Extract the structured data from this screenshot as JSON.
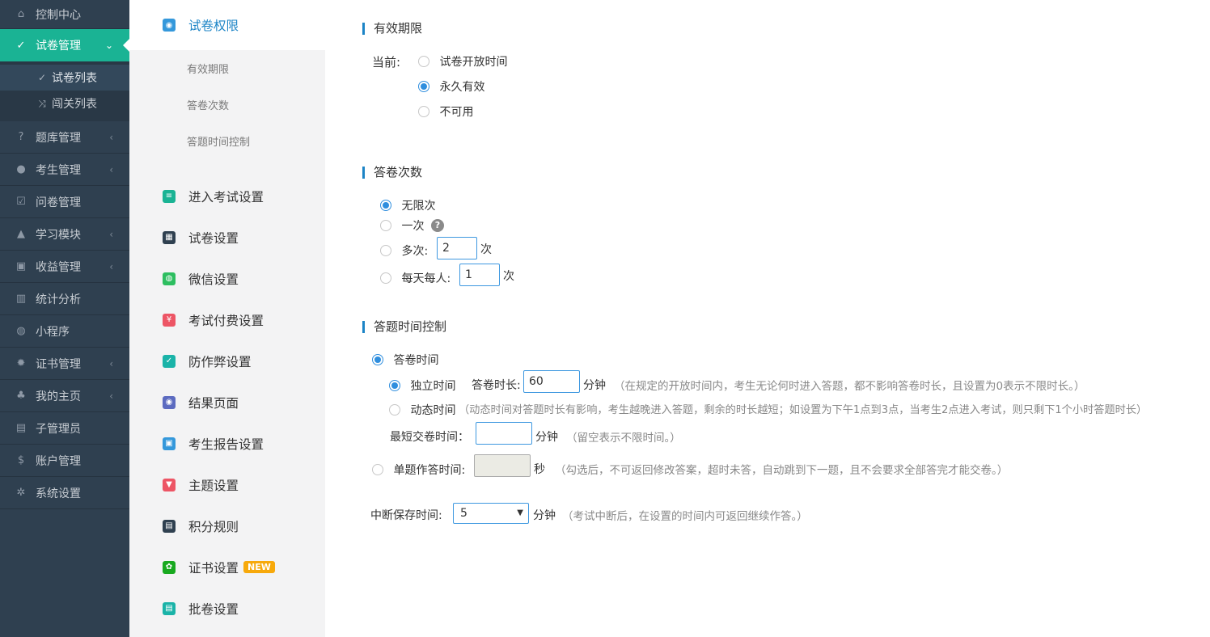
{
  "sidebar": {
    "items": [
      {
        "label": "控制中心",
        "icon": "home-icon",
        "glyph": "⌂",
        "chevron": ""
      },
      {
        "label": "试卷管理",
        "icon": "check-circle-icon",
        "glyph": "✓",
        "chevron": "⌄",
        "active": true
      },
      {
        "label": "题库管理",
        "icon": "question-circle-icon",
        "glyph": "?",
        "chevron": "‹"
      },
      {
        "label": "考生管理",
        "icon": "user-icon",
        "glyph": "●",
        "chevron": "‹"
      },
      {
        "label": "问卷管理",
        "icon": "checkbox-icon",
        "glyph": "☑",
        "chevron": ""
      },
      {
        "label": "学习模块",
        "icon": "graduation-cap-icon",
        "glyph": "▲",
        "chevron": "‹"
      },
      {
        "label": "收益管理",
        "icon": "money-icon",
        "glyph": "▣",
        "chevron": "‹"
      },
      {
        "label": "统计分析",
        "icon": "bar-chart-icon",
        "glyph": "▥",
        "chevron": ""
      },
      {
        "label": "小程序",
        "icon": "wechat-icon",
        "glyph": "◍",
        "chevron": ""
      },
      {
        "label": "证书管理",
        "icon": "certificate-icon",
        "glyph": "✹",
        "chevron": "‹"
      },
      {
        "label": "我的主页",
        "icon": "tree-icon",
        "glyph": "♣",
        "chevron": "‹"
      },
      {
        "label": "子管理员",
        "icon": "admin-icon",
        "glyph": "▤",
        "chevron": ""
      },
      {
        "label": "账户管理",
        "icon": "dollar-icon",
        "glyph": "$",
        "chevron": ""
      },
      {
        "label": "系统设置",
        "icon": "gear-icon",
        "glyph": "✲",
        "chevron": ""
      }
    ],
    "sub_items": [
      {
        "label": "试卷列表",
        "icon": "check-circle-icon",
        "glyph": "✓",
        "active": true
      },
      {
        "label": "闯关列表",
        "icon": "shuffle-icon",
        "glyph": "⤨",
        "active": false
      }
    ]
  },
  "settings_nav": {
    "items": [
      {
        "label": "试卷权限",
        "icon": "permission-icon",
        "glyph": "◉",
        "color": "#3498db",
        "active": true
      },
      {
        "label": "进入考试设置",
        "icon": "enter-exam-icon",
        "glyph": "≡",
        "color": "#1ab394"
      },
      {
        "label": "试卷设置",
        "icon": "paper-settings-icon",
        "glyph": "▦",
        "color": "#2f4050"
      },
      {
        "label": "微信设置",
        "icon": "wechat-settings-icon",
        "glyph": "◍",
        "color": "#2dbe60"
      },
      {
        "label": "考试付费设置",
        "icon": "payment-icon",
        "glyph": "¥",
        "color": "#ed5565"
      },
      {
        "label": "防作弊设置",
        "icon": "anti-cheat-icon",
        "glyph": "✓",
        "color": "#1ab3a8"
      },
      {
        "label": "结果页面",
        "icon": "eye-icon",
        "glyph": "◉",
        "color": "#5c6bc0"
      },
      {
        "label": "考生报告设置",
        "icon": "report-icon",
        "glyph": "▣",
        "color": "#3498db"
      },
      {
        "label": "主题设置",
        "icon": "shirt-icon",
        "glyph": "▼",
        "color": "#ed5565"
      },
      {
        "label": "积分规则",
        "icon": "gift-icon",
        "glyph": "▤",
        "color": "#2f4050"
      },
      {
        "label": "证书设置",
        "icon": "certificate-settings-icon",
        "glyph": "✿",
        "color": "#18a91f",
        "badge": "NEW"
      },
      {
        "label": "批卷设置",
        "icon": "grading-icon",
        "glyph": "▤",
        "color": "#1ab3a8"
      }
    ],
    "sub_items": [
      "有效期限",
      "答卷次数",
      "答题时间控制"
    ]
  },
  "validity": {
    "title": "有效期限",
    "current_label": "当前:",
    "options": [
      "试卷开放时间",
      "永久有效",
      "不可用"
    ],
    "selected": 1
  },
  "attempts": {
    "title": "答卷次数",
    "unlimited": "无限次",
    "once": "一次",
    "help": "?",
    "multiple": "多次:",
    "multiple_value": "2",
    "per_day": "每天每人:",
    "per_day_value": "1",
    "unit": "次"
  },
  "time_control": {
    "title": "答题时间控制",
    "exam_time": "答卷时间",
    "independent": "独立时间",
    "duration_label": "答卷时长:",
    "duration_value": "60",
    "minutes": "分钟",
    "independent_hint": "（在规定的开放时间内，考生无论何时进入答题，都不影响答卷时长，且设置为0表示不限时长。）",
    "dynamic": "动态时间",
    "dynamic_hint": "（动态时间对答题时长有影响，考生越晚进入答题，剩余的时长越短；如设置为下午1点到3点，当考生2点进入考试，则只剩下1个小时答题时长）",
    "min_submit_label": "最短交卷时间：",
    "min_submit_value": "",
    "min_submit_hint": "（留空表示不限时间。）",
    "per_question": "单题作答时间:",
    "per_question_value": "",
    "seconds": "秒",
    "per_question_hint": "（勾选后，不可返回修改答案，超时未答，自动跳到下一题，且不会要求全部答完才能交卷。）",
    "interrupt_label": "中断保存时间:",
    "interrupt_value": "5",
    "interrupt_hint": "（考试中断后，在设置的时间内可返回继续作答。）"
  }
}
